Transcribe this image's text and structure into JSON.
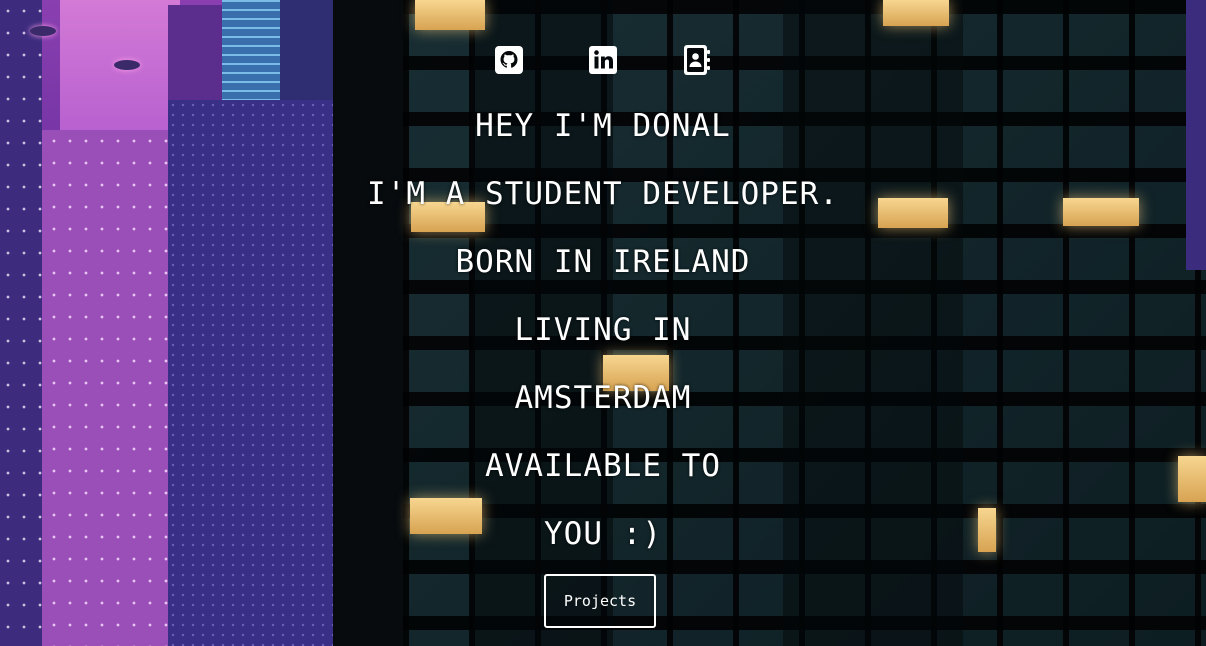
{
  "social_links": [
    {
      "icon": "github-icon",
      "label": "GitHub"
    },
    {
      "icon": "linkedin-icon",
      "label": "LinkedIn"
    },
    {
      "icon": "contact-book-icon",
      "label": "Contact"
    }
  ],
  "intro_lines": [
    "HEY I'M DONAL",
    "I'M A STUDENT DEVELOPER.",
    "BORN IN IRELAND",
    "LIVING IN",
    "AMSTERDAM",
    "AVAILABLE TO",
    "YOU :)"
  ],
  "projects_button": {
    "label": "Projects"
  },
  "colors": {
    "text": "#ffffff",
    "city_purple": "#8a3fb0",
    "window_light": "#f7d690"
  }
}
